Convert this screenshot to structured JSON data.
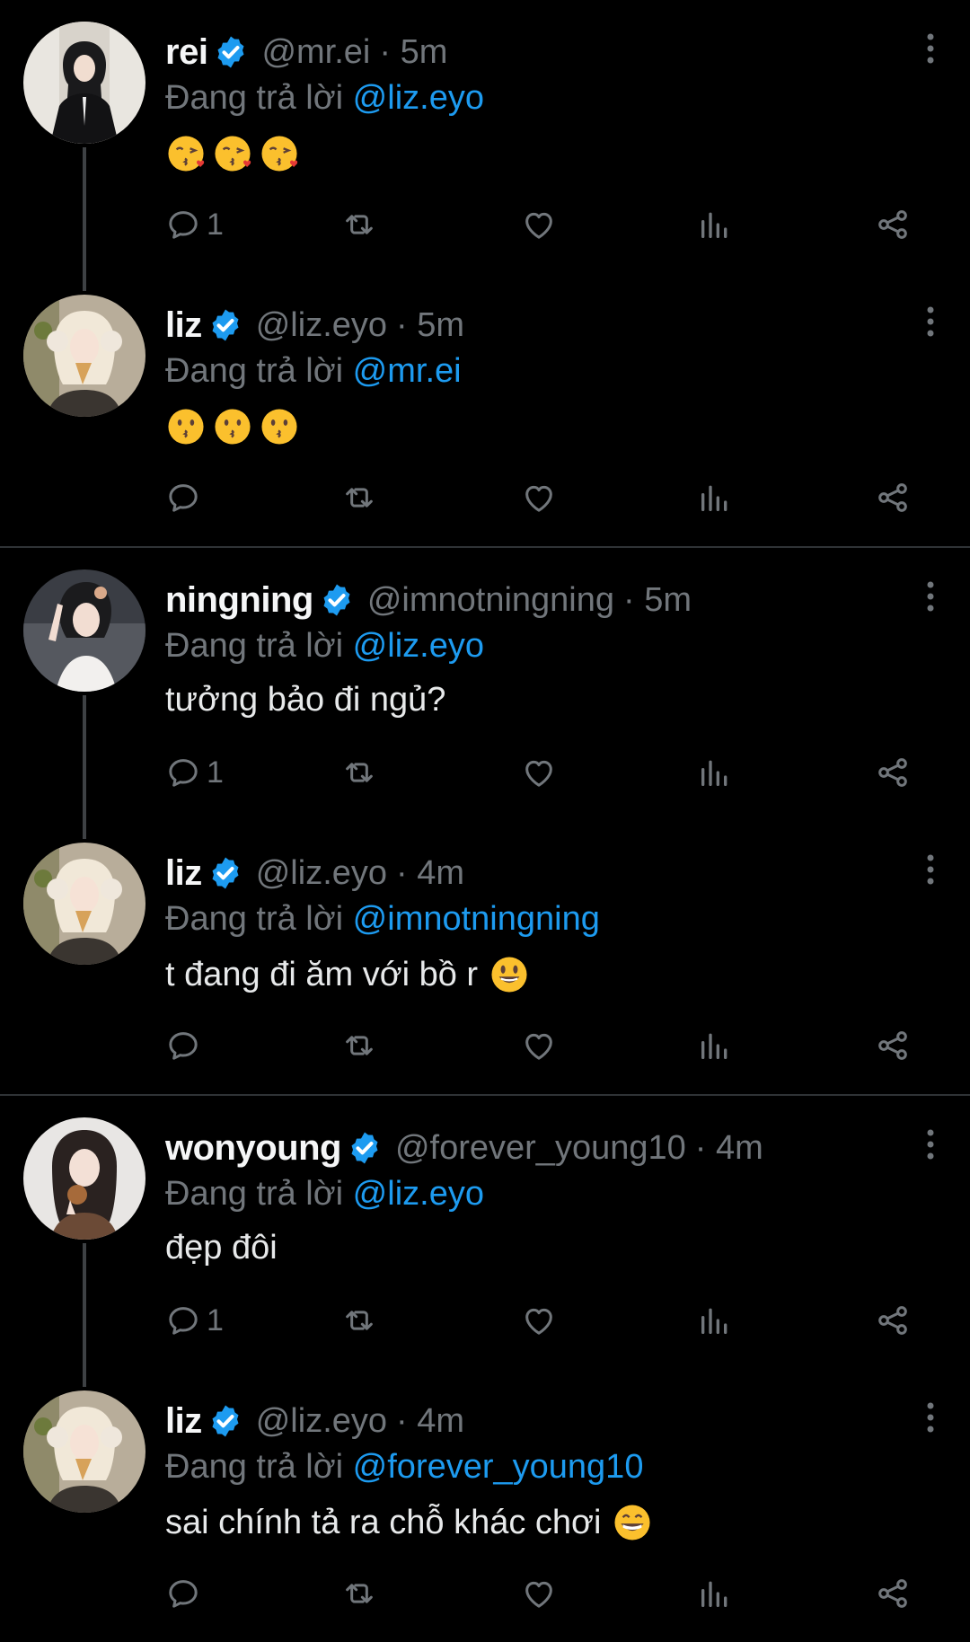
{
  "reply_prefix": "Đang trả lời",
  "colors": {
    "background": "#000000",
    "text": "#e7e9ea",
    "muted": "#71767b",
    "accent": "#1d9bf0",
    "divider": "#2f3336"
  },
  "tweets": [
    {
      "name": "rei",
      "handle": "@mr.ei",
      "time": "· 5m",
      "reply_to": "@liz.eyo",
      "text": "",
      "emoji": [
        "😘",
        "😘",
        "😘"
      ],
      "reply_count": "1"
    },
    {
      "name": "liz",
      "handle": "@liz.eyo",
      "time": "· 5m",
      "reply_to": "@mr.ei",
      "text": "",
      "emoji": [
        "😗",
        "😗",
        "😗"
      ],
      "reply_count": ""
    },
    {
      "name": "ningning",
      "handle": "@imnotningning",
      "time": "· 5m",
      "reply_to": "@liz.eyo",
      "text": "tưởng bảo đi ngủ?",
      "emoji": [],
      "reply_count": "1"
    },
    {
      "name": "liz",
      "handle": "@liz.eyo",
      "time": "· 4m",
      "reply_to": "@imnotningning",
      "text": "t đang đi ăm với bồ r",
      "emoji": [
        "😃"
      ],
      "reply_count": ""
    },
    {
      "name": "wonyoung",
      "handle": "@forever_young10",
      "time": "· 4m",
      "reply_to": "@liz.eyo",
      "text": "đẹp đôi",
      "emoji": [],
      "reply_count": "1"
    },
    {
      "name": "liz",
      "handle": "@liz.eyo",
      "time": "· 4m",
      "reply_to": "@forever_young10",
      "text": "sai chính tả ra chỗ khác chơi",
      "emoji": [
        "😄"
      ],
      "reply_count": ""
    }
  ]
}
